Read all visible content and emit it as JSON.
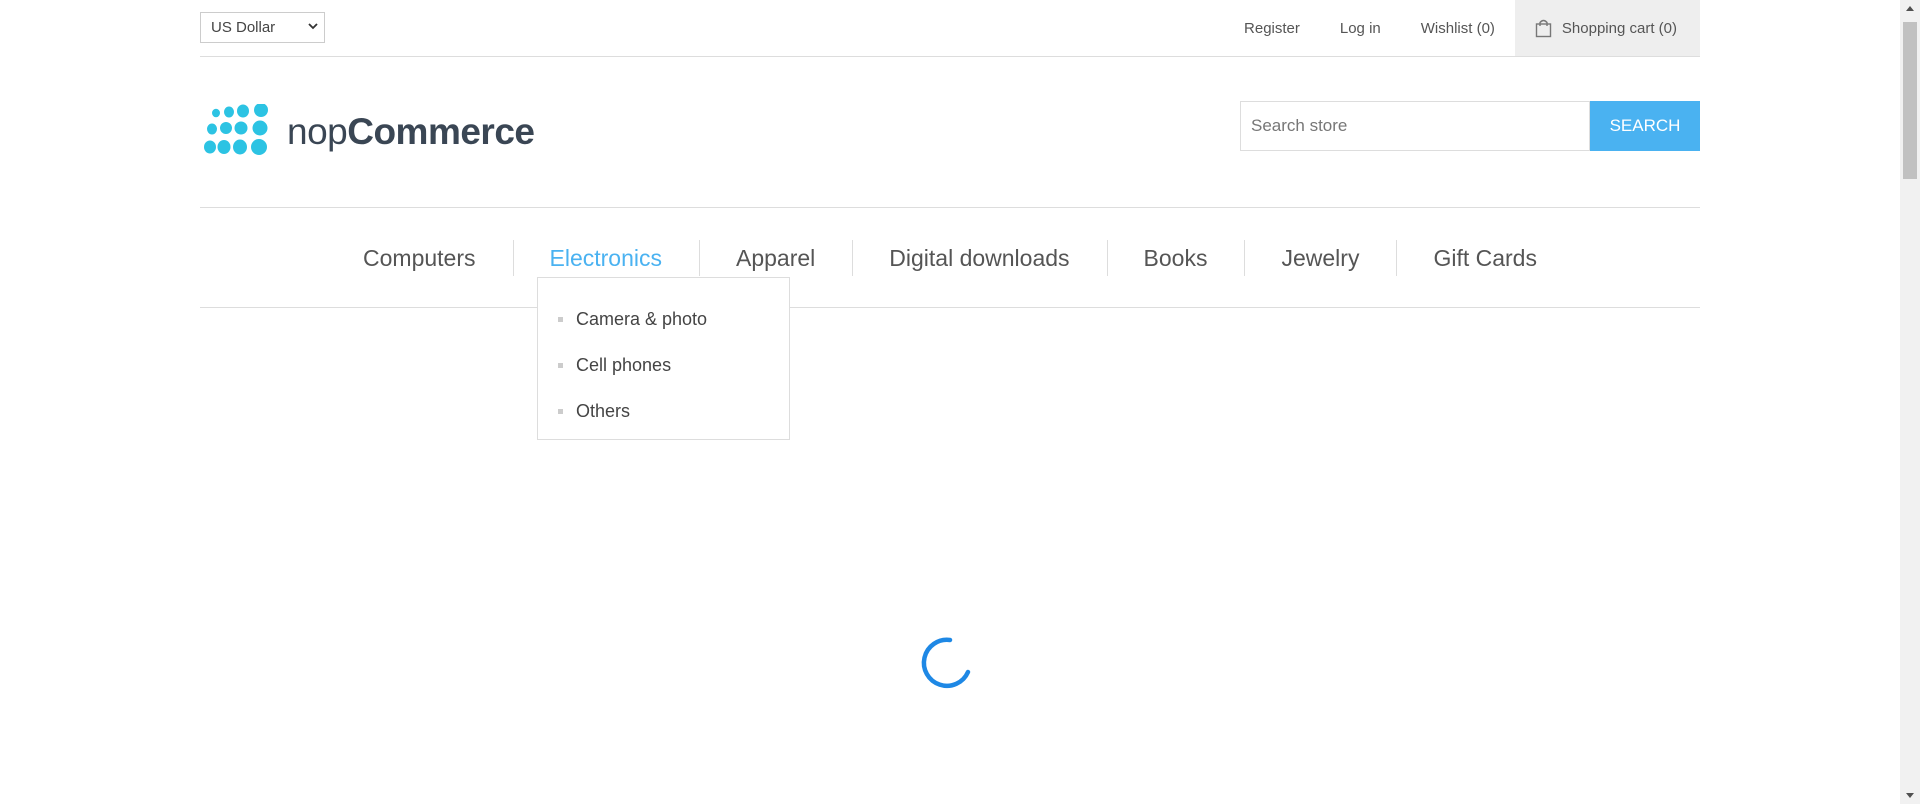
{
  "header": {
    "currency": "US Dollar",
    "links": {
      "register": "Register",
      "login": "Log in",
      "wishlist": "Wishlist (0)",
      "cart": "Shopping cart (0)"
    }
  },
  "logo": {
    "part1": "nop",
    "part2": "Commerce"
  },
  "search": {
    "placeholder": "Search store",
    "button": "SEARCH"
  },
  "menu": {
    "items": [
      "Computers",
      "Electronics",
      "Apparel",
      "Digital downloads",
      "Books",
      "Jewelry",
      "Gift Cards"
    ],
    "active_item": "Electronics",
    "submenu": [
      "Camera & photo",
      "Cell phones",
      "Others"
    ]
  },
  "colors": {
    "accent": "#4ab2f1",
    "spinner": "#1e88e5",
    "logo_dots": "#2cc3e3"
  }
}
